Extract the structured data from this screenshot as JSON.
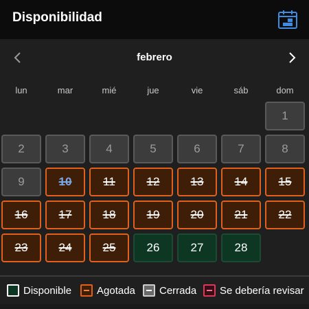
{
  "header": {
    "title": "Disponibilidad",
    "icon": "calendar-icon",
    "accent": "#3f8de2"
  },
  "calendar": {
    "month": "febrero",
    "prev_icon": "chevron-left-icon",
    "next_icon": "chevron-right-icon",
    "weekdays": [
      "lun",
      "mar",
      "mié",
      "jue",
      "vie",
      "sáb",
      "dom"
    ],
    "days": [
      {
        "label": "1",
        "status": "closed"
      },
      {
        "label": "2",
        "status": "closed"
      },
      {
        "label": "3",
        "status": "closed"
      },
      {
        "label": "4",
        "status": "closed"
      },
      {
        "label": "5",
        "status": "closed"
      },
      {
        "label": "6",
        "status": "closed"
      },
      {
        "label": "7",
        "status": "closed"
      },
      {
        "label": "8",
        "status": "closed"
      },
      {
        "label": "9",
        "status": "closed"
      },
      {
        "label": "10",
        "status": "soldout",
        "today": true
      },
      {
        "label": "11",
        "status": "soldout"
      },
      {
        "label": "12",
        "status": "soldout"
      },
      {
        "label": "13",
        "status": "soldout"
      },
      {
        "label": "14",
        "status": "soldout"
      },
      {
        "label": "15",
        "status": "soldout"
      },
      {
        "label": "16",
        "status": "soldout"
      },
      {
        "label": "17",
        "status": "soldout"
      },
      {
        "label": "18",
        "status": "soldout"
      },
      {
        "label": "19",
        "status": "soldout"
      },
      {
        "label": "20",
        "status": "soldout"
      },
      {
        "label": "21",
        "status": "soldout"
      },
      {
        "label": "22",
        "status": "soldout"
      },
      {
        "label": "23",
        "status": "soldout"
      },
      {
        "label": "24",
        "status": "soldout"
      },
      {
        "label": "25",
        "status": "soldout"
      },
      {
        "label": "26",
        "status": "available"
      },
      {
        "label": "27",
        "status": "available"
      },
      {
        "label": "28",
        "status": "available"
      }
    ]
  },
  "legend": {
    "available": "Disponible",
    "soldout": "Agotada",
    "closed": "Cerrada",
    "review": "Se debería revisar"
  },
  "colors": {
    "available": "#0d3722",
    "soldout": "#e0601c",
    "closed": "#5a5a5a",
    "review": "#d83a5c",
    "today": "#7aa7e6"
  }
}
